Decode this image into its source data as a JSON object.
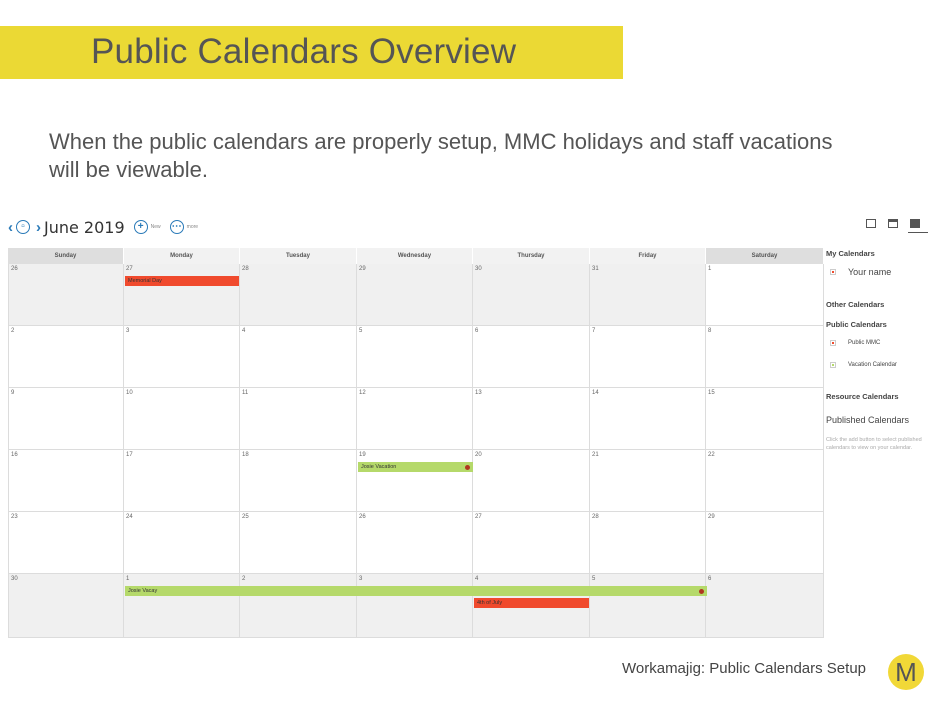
{
  "slide": {
    "title": "Public Calendars Overview",
    "subtitle": "When the public calendars are properly setup, MMC holidays and staff vacations will be viewable.",
    "footer": "Workamajig: Public Calendars Setup",
    "logo_letter": "M"
  },
  "toolbar": {
    "prev": "‹",
    "next": "›",
    "month": "June 2019",
    "new_label": "New",
    "more_label": "more"
  },
  "weekdays": [
    "Sunday",
    "Monday",
    "Tuesday",
    "Wednesday",
    "Thursday",
    "Friday",
    "Saturday"
  ],
  "weeks": [
    [
      "26",
      "27",
      "28",
      "29",
      "30",
      "31",
      "1"
    ],
    [
      "2",
      "3",
      "4",
      "5",
      "6",
      "7",
      "8"
    ],
    [
      "9",
      "10",
      "11",
      "12",
      "13",
      "14",
      "15"
    ],
    [
      "16",
      "17",
      "18",
      "19",
      "20",
      "21",
      "22"
    ],
    [
      "23",
      "24",
      "25",
      "26",
      "27",
      "28",
      "29"
    ],
    [
      "30",
      "1",
      "2",
      "3",
      "4",
      "5",
      "6"
    ]
  ],
  "events": {
    "memorial": "Memorial Day",
    "josie_vacation": "Josie Vacation",
    "josie_vacay": "Josie Vacay",
    "july4": "4th of July"
  },
  "side": {
    "my_calendars": "My Calendars",
    "your_name": "Your name",
    "other_calendars": "Other Calendars",
    "public_calendars": "Public Calendars",
    "public_mmc": "Public MMC",
    "vacation_calendar": "Vacation Calendar",
    "resource_calendars": "Resource Calendars",
    "published_calendars": "Published Calendars",
    "published_note": "Click the add button to select published calendars to view on your calendar."
  },
  "colors": {
    "title_bar": "#ebd934",
    "holiday_event": "#f04a2d",
    "vacation_event": "#b5d96a",
    "accent": "#2a7ab8"
  }
}
